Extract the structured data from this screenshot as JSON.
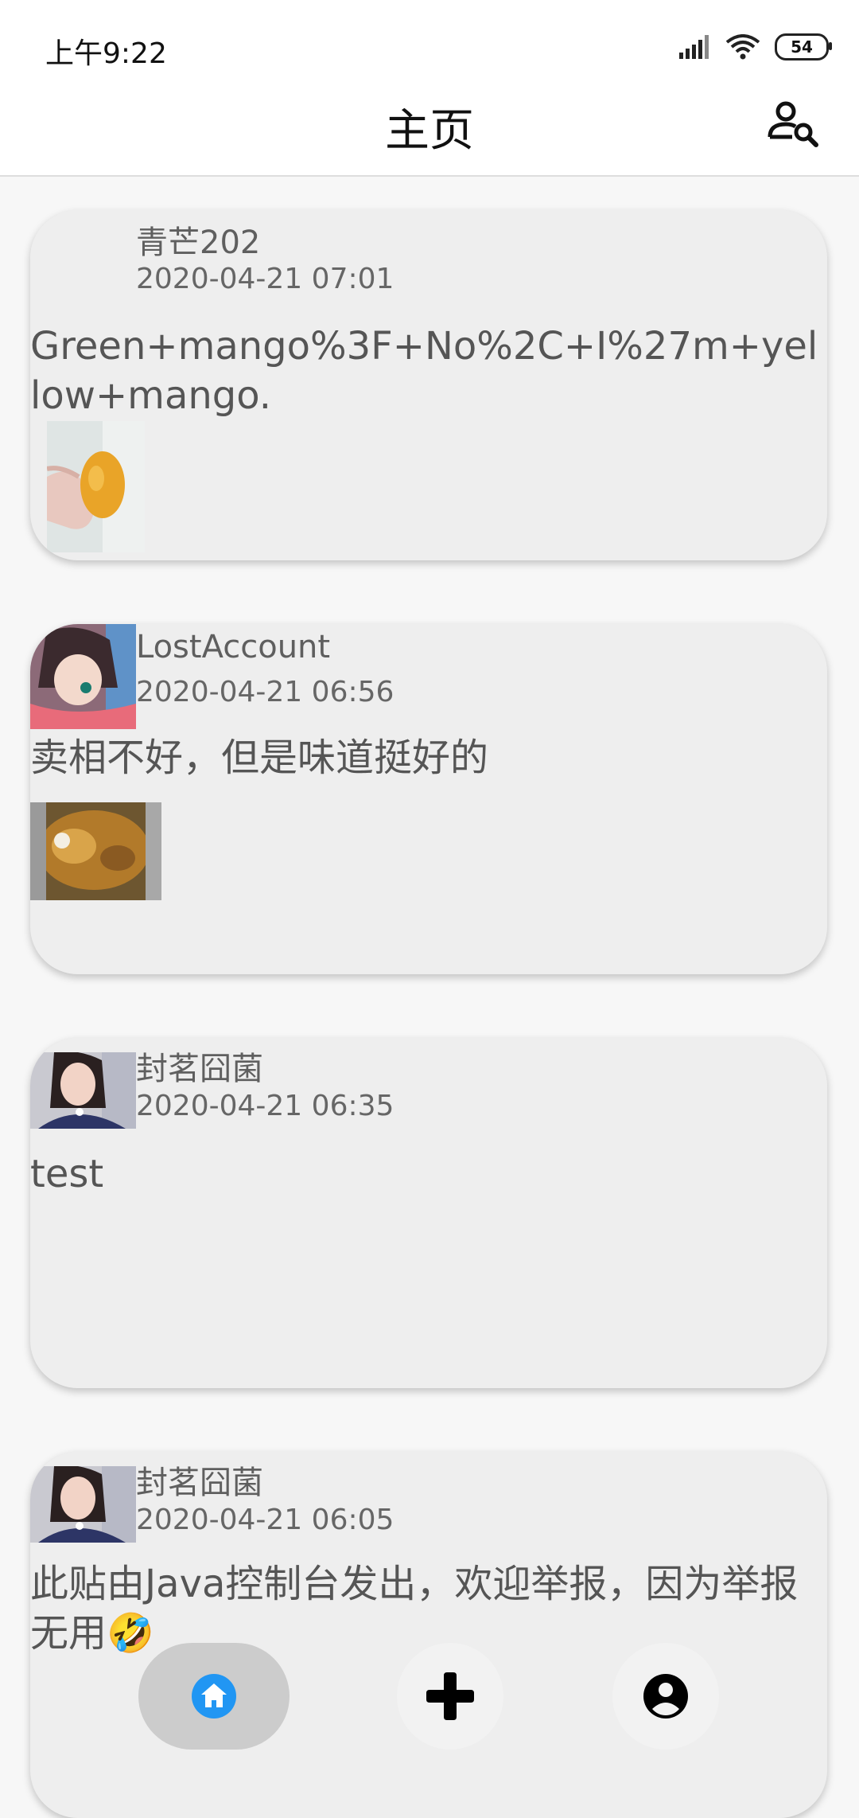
{
  "status_bar": {
    "time": "上午9:22",
    "battery": "54"
  },
  "header": {
    "title": "主页"
  },
  "posts": [
    {
      "author": "青芒202",
      "time": "2020-04-21 07:01",
      "text": "Green+mango%3F+No%2C+I%27m+yellow+mango."
    },
    {
      "author": "LostAccount",
      "time": "2020-04-21 06:56",
      "text": "卖相不好，但是味道挺好的"
    },
    {
      "author": "封茗囧菌",
      "time": "2020-04-21 06:35",
      "text": "test"
    },
    {
      "author": "封茗囧菌",
      "time": "2020-04-21 06:05",
      "text": "此贴由Java控制台发出，欢迎举报，因为举报无用🤣"
    }
  ],
  "bottom_nav": {
    "items": [
      {
        "icon": "home-icon",
        "active": true
      },
      {
        "icon": "plus-icon",
        "active": false
      },
      {
        "icon": "account-icon",
        "active": false
      }
    ]
  },
  "colors": {
    "accent": "#2196f3",
    "card": "#eeeeee",
    "active_nav_bg": "#cccccc"
  }
}
